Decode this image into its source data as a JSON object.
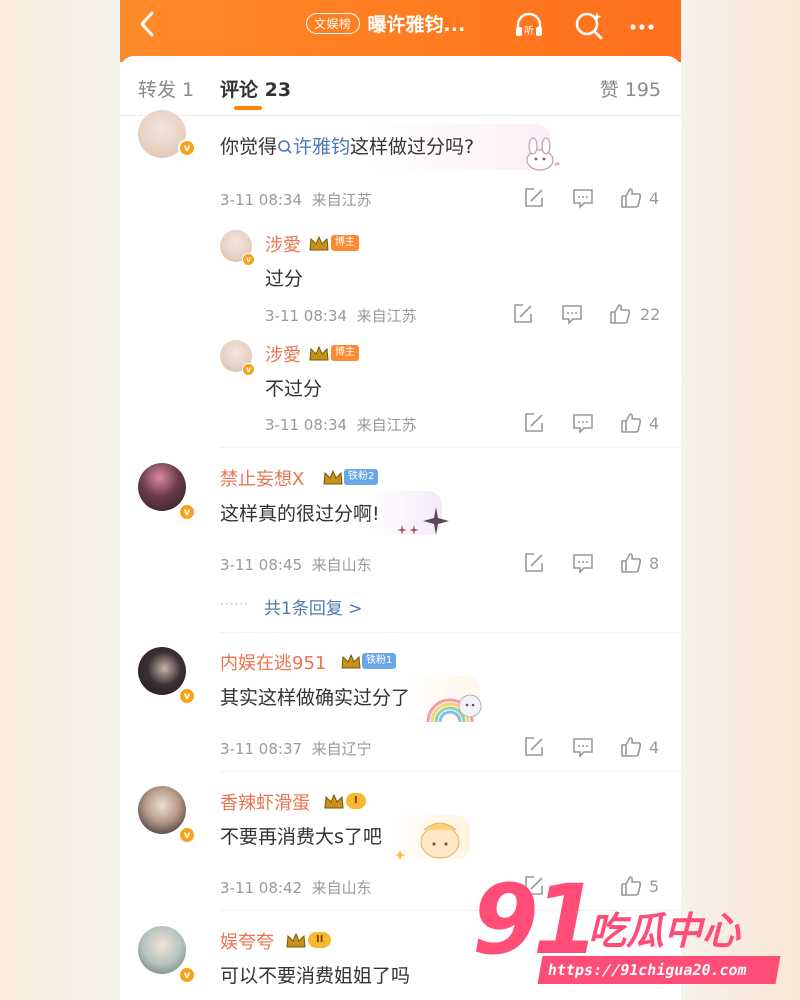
{
  "header": {
    "topic_badge": "文娱榜",
    "title": "曝许雅钧..."
  },
  "tabs": {
    "repost": "转发 1",
    "comments": "评论 23",
    "likes": "赞 195"
  },
  "comments": [
    {
      "text_prefix": "你觉得",
      "text_link": "许雅钧",
      "text_suffix": "这样做过分吗?",
      "time": "3-11 08:34",
      "location": "来自江苏",
      "likes": "4",
      "replies": [
        {
          "user": "涉愛",
          "badge": "博主",
          "text": "过分",
          "time": "3-11 08:34",
          "location": "来自江苏",
          "likes": "22"
        },
        {
          "user": "涉愛",
          "badge": "博主",
          "text": "不过分",
          "time": "3-11 08:34",
          "location": "来自江苏",
          "likes": "4"
        }
      ]
    },
    {
      "user": "禁止妄想X",
      "badge": "铁粉2",
      "text": "这样真的很过分啊!",
      "time": "3-11 08:45",
      "location": "来自山东",
      "likes": "8",
      "reply_link": "共1条回复 >"
    },
    {
      "user": "内娱在逃951",
      "badge": "铁粉1",
      "text": "其实这样做确实过分了",
      "time": "3-11 08:37",
      "location": "来自辽宁",
      "likes": "4"
    },
    {
      "user": "香辣虾滑蛋",
      "badge": "I",
      "text": "不要再消费大s了吧",
      "time": "3-11 08:42",
      "location": "来自山东",
      "likes": "5"
    },
    {
      "user": "娱夸夸",
      "badge": "II",
      "text": "可以不要消费姐姐了吗"
    }
  ],
  "watermark": {
    "number": "91",
    "name": "吃瓜中心",
    "url": "https://91chigua20.com"
  },
  "colors": {
    "header_orange": "#ff7a1f",
    "username": "#eb7350",
    "link": "#4e78b3",
    "watermark": "#ff4d78"
  }
}
